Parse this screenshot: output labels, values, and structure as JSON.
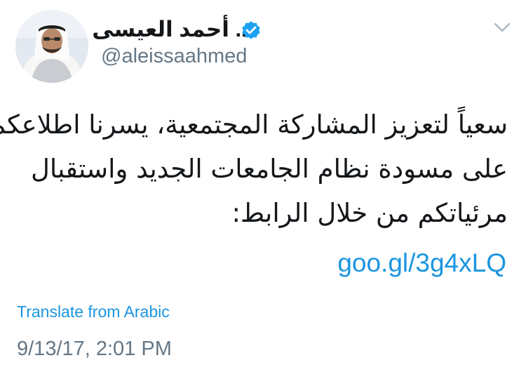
{
  "author": {
    "display_name": "د. أحمد العيسى",
    "handle": "@aleissaahmed",
    "verified_icon": "verified-badge-icon",
    "avatar_icon": "avatar-photo"
  },
  "menu": {
    "icon": "chevron-down-icon"
  },
  "tweet": {
    "text_lines": [
      "سعياً لتعزيز المشاركة المجتمعية، يسرنا اطلاعكم",
      "على مسودة نظام الجامعات الجديد واستقبال",
      "مرئياتكم من خلال الرابط:"
    ],
    "link": "goo.gl/3g4xLQ",
    "translate_label": "Translate from Arabic",
    "timestamp": "9/13/17, 2:01 PM"
  },
  "colors": {
    "link_blue": "#1b95e0",
    "muted_gray": "#657786",
    "text_dark": "#14171a",
    "verified_blue": "#1da1f2"
  }
}
